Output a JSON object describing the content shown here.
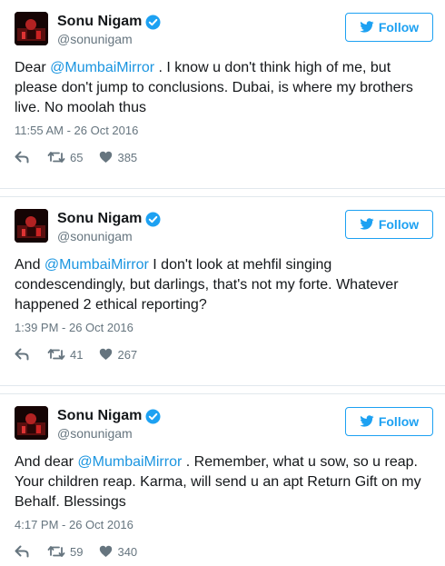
{
  "tweets": [
    {
      "display_name": "Sonu Nigam",
      "handle": "@sonunigam",
      "follow_label": "Follow",
      "text_before": "Dear ",
      "mention": "@MumbaiMirror",
      "text_after": " . I know u don't think high of me, but please don't jump to conclusions. Dubai, is where my brothers live. No moolah thus",
      "timestamp": "11:55 AM - 26 Oct 2016",
      "retweets": "65",
      "likes": "385"
    },
    {
      "display_name": "Sonu Nigam",
      "handle": "@sonunigam",
      "follow_label": "Follow",
      "text_before": "And ",
      "mention": "@MumbaiMirror",
      "text_after": " I don't look at mehfil singing condescendingly, but darlings, that's not my forte. Whatever happened 2 ethical reporting?",
      "timestamp": "1:39 PM - 26 Oct 2016",
      "retweets": "41",
      "likes": "267"
    },
    {
      "display_name": "Sonu Nigam",
      "handle": "@sonunigam",
      "follow_label": "Follow",
      "text_before": "And dear ",
      "mention": "@MumbaiMirror",
      "text_after": " . Remember, what u sow, so u reap. Your children reap. Karma, will send u an apt Return Gift on my Behalf. Blessings",
      "timestamp": "4:17 PM - 26 Oct 2016",
      "retweets": "59",
      "likes": "340"
    }
  ],
  "icons": {
    "verified": "verified-badge-icon",
    "follow": "twitter-bird-icon",
    "reply": "reply-icon",
    "retweet": "retweet-icon",
    "like": "heart-icon"
  },
  "colors": {
    "accent": "#1da1f2",
    "mention": "#1b95e0",
    "muted": "#66757f",
    "text": "#14171a"
  }
}
